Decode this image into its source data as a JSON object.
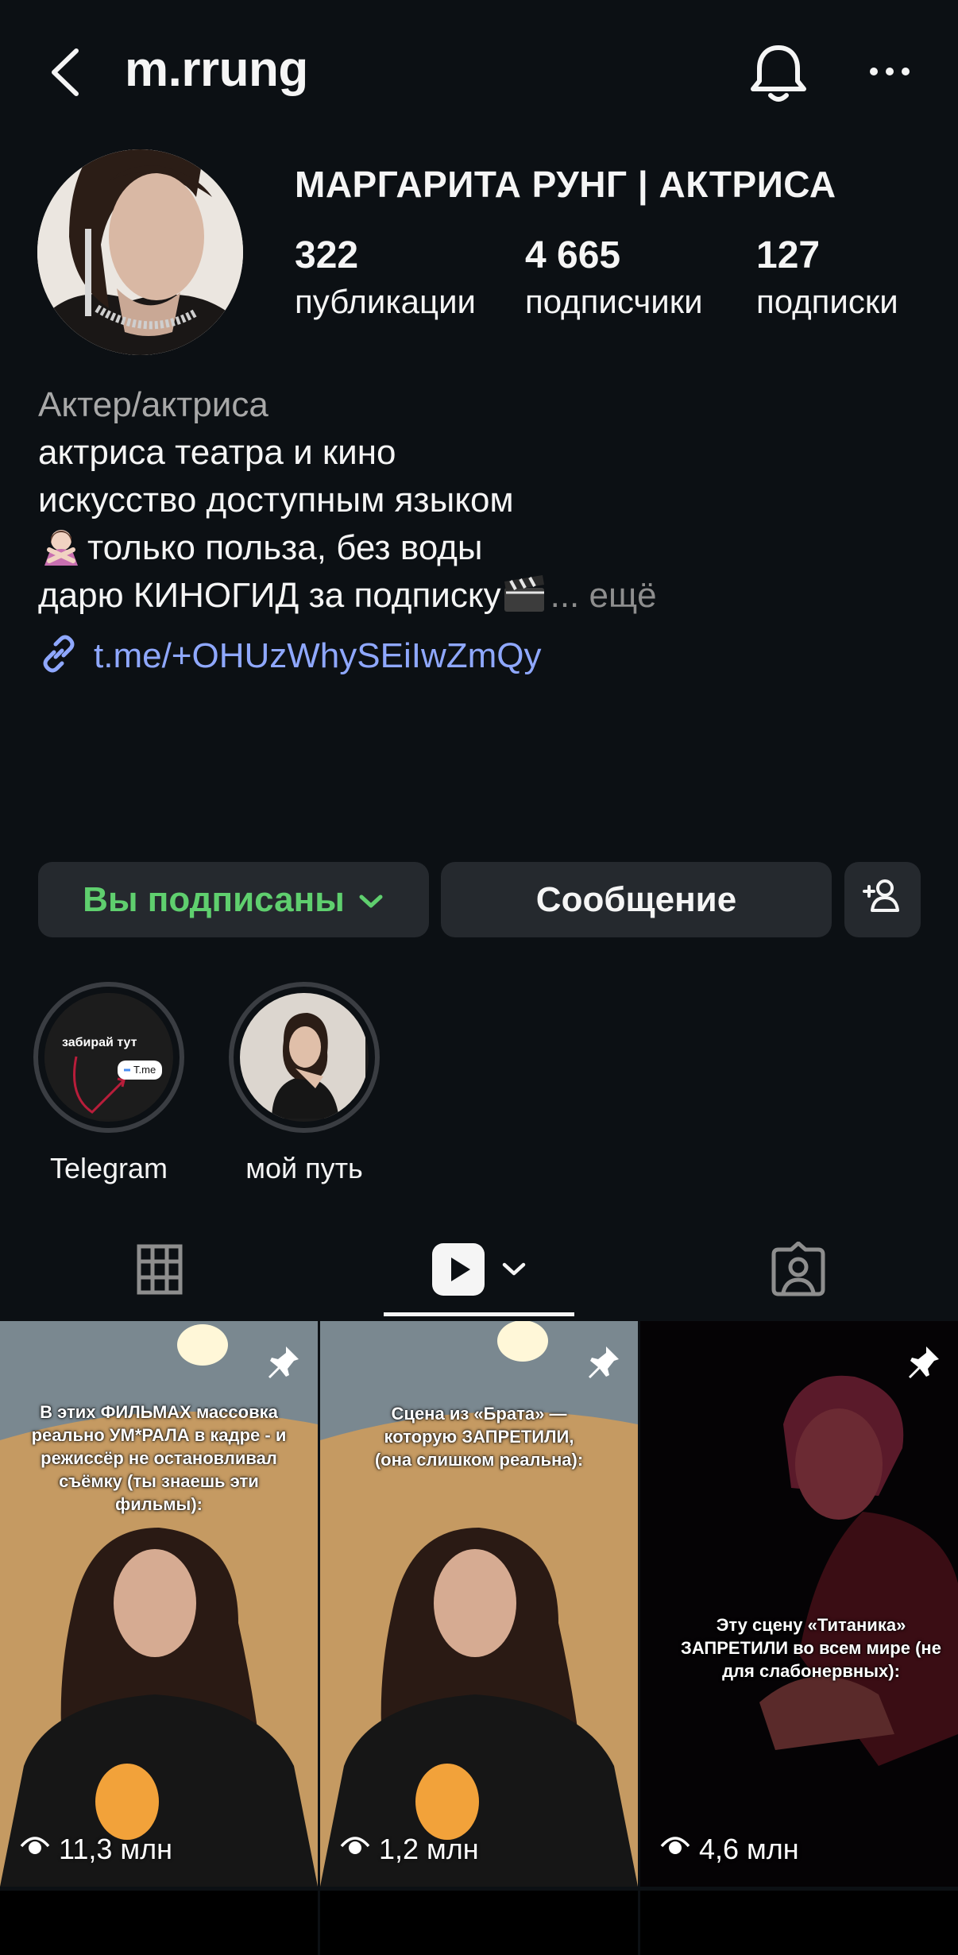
{
  "header": {
    "username": "m.rrung"
  },
  "profile": {
    "full_name": "МАРГАРИТА РУНГ | АКТРИСА",
    "stats": [
      {
        "value": "322",
        "label": "публикации"
      },
      {
        "value": "4 665",
        "label": "подписчики"
      },
      {
        "value": "127",
        "label": "подписки"
      }
    ],
    "category": "Актер/актриса",
    "bio_lines": [
      "актриса театра и кино",
      "искусство доступным языком",
      "только польза, без воды",
      "дарю КИНОГИД за подписку"
    ],
    "bio_more": "... ещё",
    "link": "t.me/+OHUzWhySEiIwZmQy"
  },
  "buttons": {
    "following_label": "Вы подписаны",
    "message_label": "Сообщение"
  },
  "highlights": [
    {
      "label": "Telegram",
      "cover_text": "забирай тут",
      "cover_chip": "T.me"
    },
    {
      "label": "мой путь"
    }
  ],
  "tabs": [
    {
      "name": "grid",
      "icon": "grid-icon"
    },
    {
      "name": "reels",
      "icon": "reels-icon",
      "active": true
    },
    {
      "name": "tagged",
      "icon": "tagged-icon"
    }
  ],
  "posts": [
    {
      "caption": "В этих ФИЛЬМАХ массовка реально УМ*РАЛА в кадре - и режиссёр не остановливал съёмку (ты знаешь эти фильмы):",
      "views": "11,3 млн",
      "pinned": true
    },
    {
      "caption": "Сцена из «Брата» — которую ЗАПРЕТИЛИ, (она слишком реальна):",
      "views": "1,2 млн",
      "pinned": true
    },
    {
      "caption": "Эту сцену «Титаника» ЗАПРЕТИЛИ во всем мире (не для слабонервных):",
      "views": "4,6 млн",
      "pinned": true
    }
  ],
  "colors": {
    "background": "#0c1014",
    "button_bg": "#25292e",
    "following_green": "#5fcf6e",
    "link_blue": "#8fa8ff"
  }
}
